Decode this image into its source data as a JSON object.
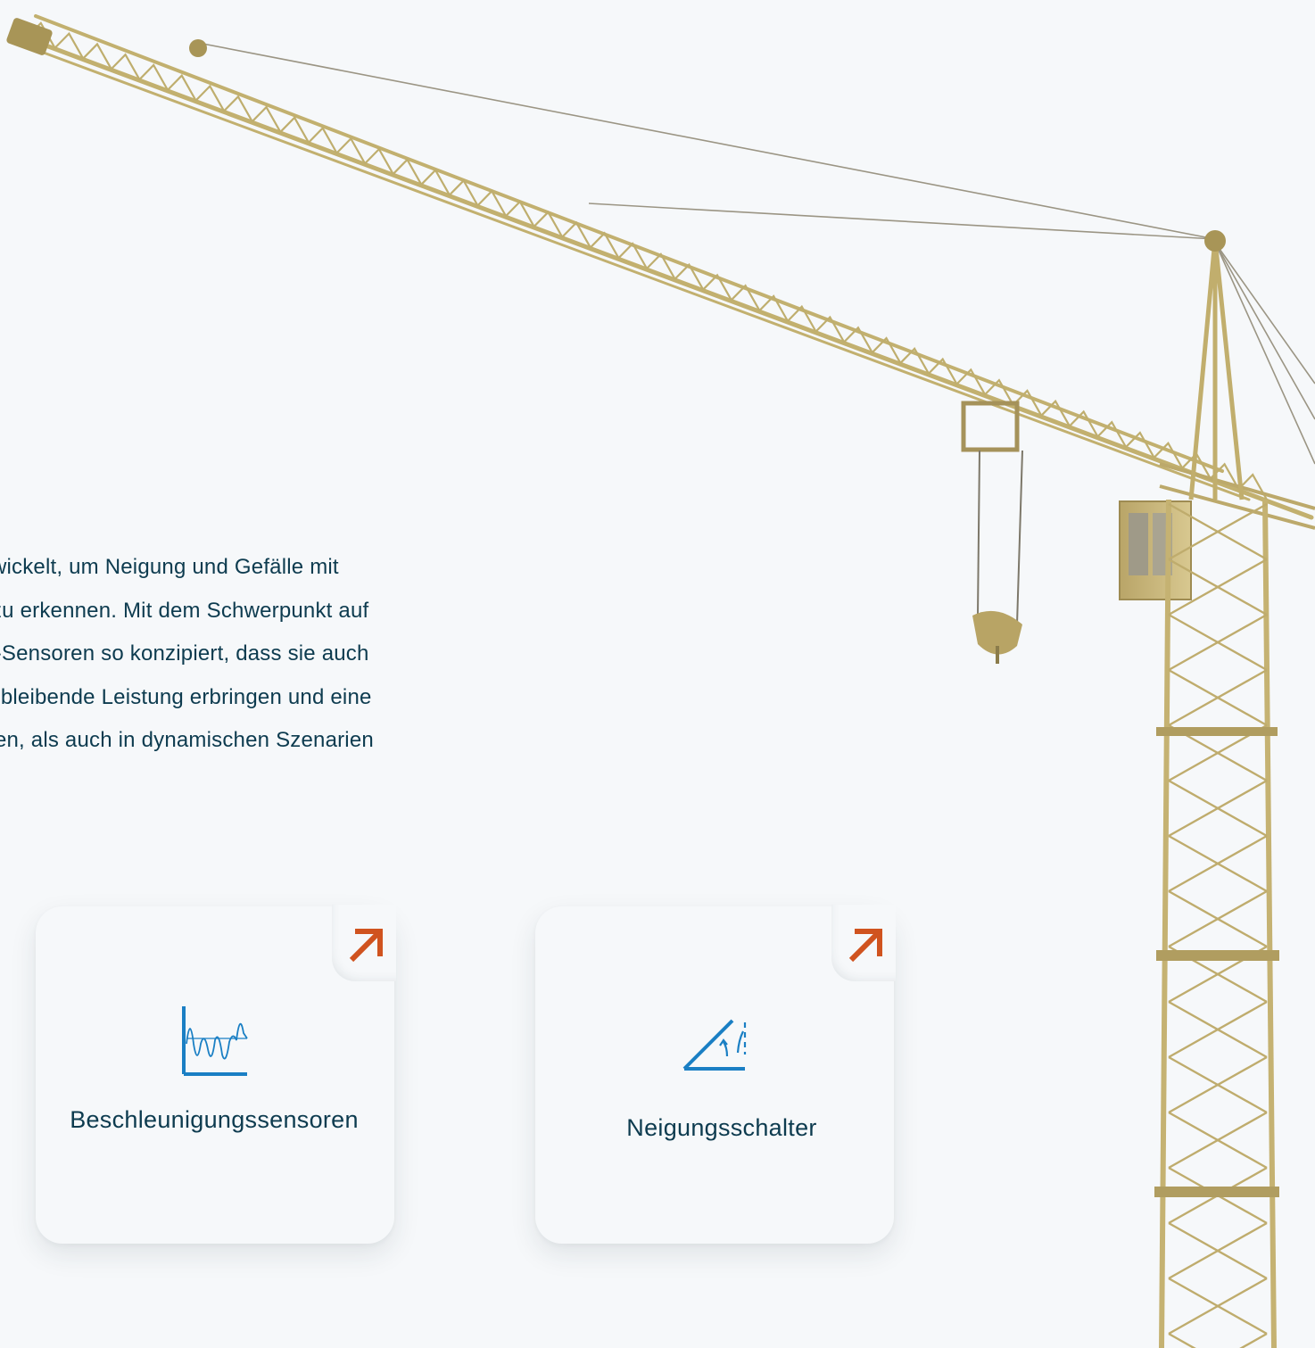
{
  "intro": {
    "text": "entwickelt, um Neigung und Gefälle mit\non zu erkennen. Mit dem Schwerpunkt auf\nQG-Sensoren so konzipiert, dass sie auch\neichbleibende Leistung erbringen und eine\nschen, als auch in dynamischen Szenarien"
  },
  "cards": [
    {
      "label": "Beschleunigungssensoren",
      "icon": "acceleration-signal-icon",
      "link_icon": "arrow-up-right-icon"
    },
    {
      "label": "Neigungsschalter",
      "icon": "tilt-angle-icon",
      "link_icon": "arrow-up-right-icon"
    }
  ],
  "colors": {
    "background": "#f6f8fa",
    "text": "#0d3b4f",
    "icon_blue": "#1a7fc4",
    "arrow_orange": "#d0531f",
    "crane": "#c7b679"
  }
}
